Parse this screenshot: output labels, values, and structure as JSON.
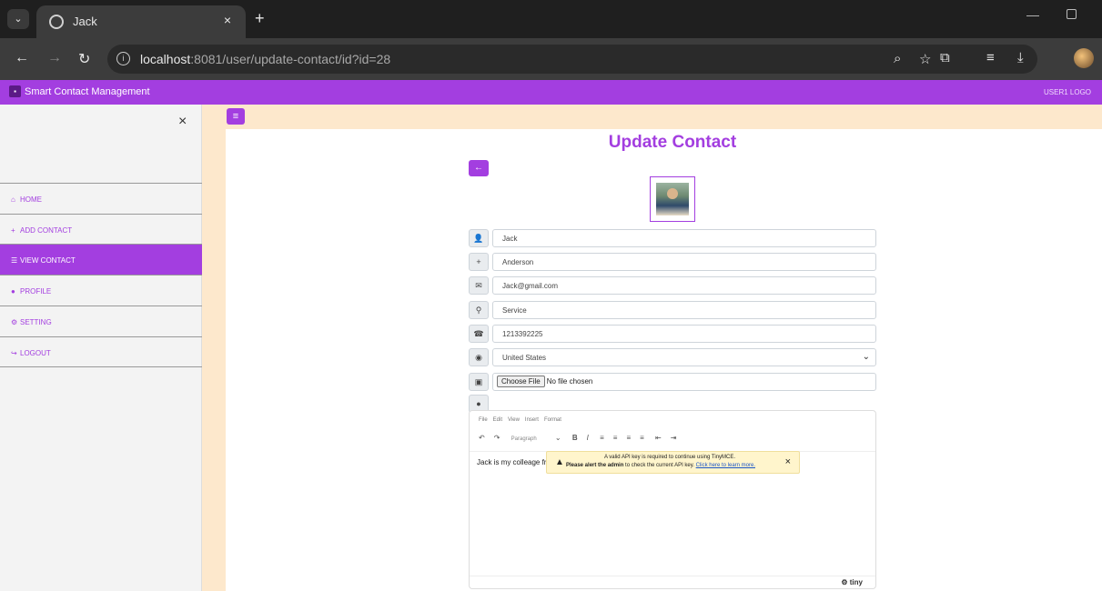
{
  "browser": {
    "tab_title": "Jack",
    "tab_close": "×",
    "new_tab": "+",
    "url_host": "localhost",
    "url_rest": ":8081/user/update-contact/id?id=28"
  },
  "app": {
    "brand": "Smart Contact Management",
    "user_link": "USER1  LOGO",
    "accent_color": "#a33ee0",
    "cream_color": "#fde8cc"
  },
  "sidebar": {
    "close": "×",
    "items": [
      {
        "icon": "home-icon",
        "glyph": "⌂",
        "label": "HOME",
        "active": false
      },
      {
        "icon": "plus-icon",
        "glyph": "+",
        "label": "ADD CONTACT",
        "active": false
      },
      {
        "icon": "list-icon",
        "glyph": "☰",
        "label": "VIEW CONTACT",
        "active": true
      },
      {
        "icon": "user-icon",
        "glyph": "●",
        "label": "PROFILE",
        "active": false
      },
      {
        "icon": "gear-icon",
        "glyph": "⚙",
        "label": "SETTING",
        "active": false
      },
      {
        "icon": "logout-icon",
        "glyph": "↪",
        "label": "LOGOUT",
        "active": false
      }
    ]
  },
  "form": {
    "title": "Update Contact",
    "name": "Jack",
    "second_name": "Anderson",
    "email": "Jack@gmail.com",
    "work": "Service",
    "phone": "1213392225",
    "country": "United States",
    "file_button": "Choose File",
    "file_status": "No file chosen"
  },
  "editor": {
    "menu": [
      "File",
      "Edit",
      "View",
      "Insert",
      "Format"
    ],
    "paragraph": "Paragraph",
    "content": "Jack is my colleage fro",
    "logo": "tiny",
    "alert_line1": "A valid API key is required to continue using TinyMCE.",
    "alert_bold": "Please alert the admin",
    "alert_mid": " to check the current API key. ",
    "alert_link": "Click here to learn more."
  }
}
